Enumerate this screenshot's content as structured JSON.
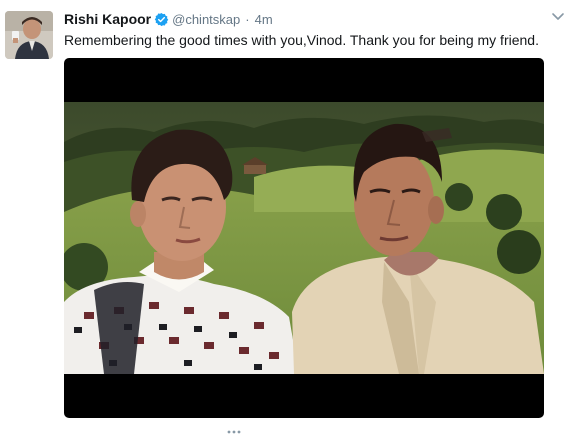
{
  "tweet": {
    "author_name": "Rishi Kapoor",
    "handle": "@chintskap",
    "separator": "·",
    "time": "4m",
    "text": "Remembering the good times with you,Vinod. Thank you for being my friend."
  },
  "icons": {
    "verified": "verified-badge-icon",
    "caret": "chevron-down-icon"
  },
  "colors": {
    "verified_blue": "#1da1f2",
    "name": "#14171a",
    "meta_gray": "#657786",
    "media_letterbox": "#000000"
  }
}
